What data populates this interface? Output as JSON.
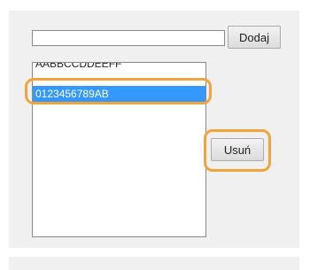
{
  "form": {
    "input_value": "",
    "add_label": "Dodaj",
    "remove_label": "Usuń"
  },
  "list": {
    "items": [
      {
        "text": "AABBCCDDEEFF"
      },
      {
        "text": "0123456789AB",
        "selected": true
      }
    ]
  },
  "colors": {
    "highlight": "#f2a33a",
    "selection": "#3399ff"
  }
}
